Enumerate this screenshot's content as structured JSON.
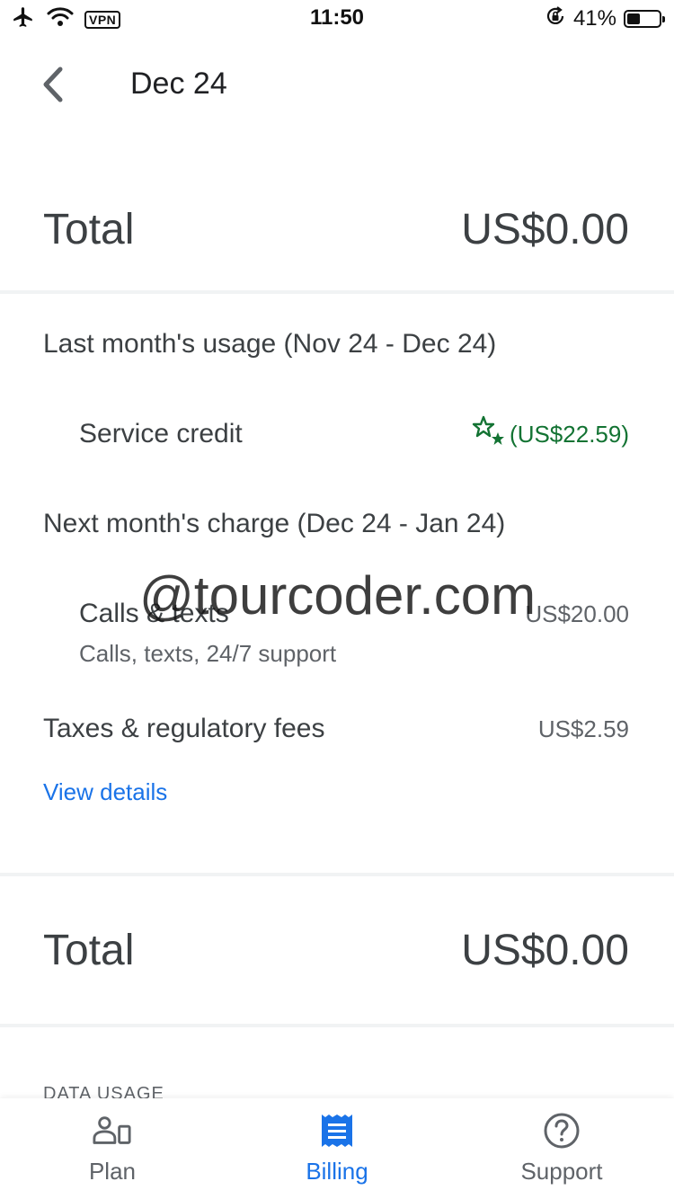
{
  "status_bar": {
    "vpn": "VPN",
    "time": "11:50",
    "battery_percent": "41%",
    "battery_level": 0.41
  },
  "header": {
    "title": "Dec 24"
  },
  "summary_top": {
    "total_label": "Total",
    "total_value": "US$0.00"
  },
  "last_month": {
    "heading": "Last month's usage (Nov 24 - Dec 24)",
    "items": [
      {
        "label": "Service credit",
        "value": "(US$22.59)",
        "icon": "star-credit-icon"
      }
    ]
  },
  "next_month": {
    "heading": "Next month's charge (Dec 24 - Jan 24)",
    "items": [
      {
        "label": "Calls & texts",
        "sub": "Calls, texts, 24/7 support",
        "value": "US$20.00"
      }
    ]
  },
  "taxes": {
    "label": "Taxes & regulatory fees",
    "value": "US$2.59"
  },
  "view_details": "View details",
  "summary_bottom": {
    "total_label": "Total",
    "total_value": "US$0.00"
  },
  "data_usage_label": "DATA USAGE",
  "watermark": "@tourcoder.com",
  "bottom_nav": {
    "items": [
      {
        "label": "Plan",
        "icon": "plan-icon"
      },
      {
        "label": "Billing",
        "icon": "billing-icon",
        "active": true
      },
      {
        "label": "Support",
        "icon": "support-icon"
      }
    ]
  },
  "colors": {
    "accent": "#1a73e8",
    "credit_green": "#137333",
    "text_primary": "#3c4043",
    "text_secondary": "#5f6368"
  }
}
